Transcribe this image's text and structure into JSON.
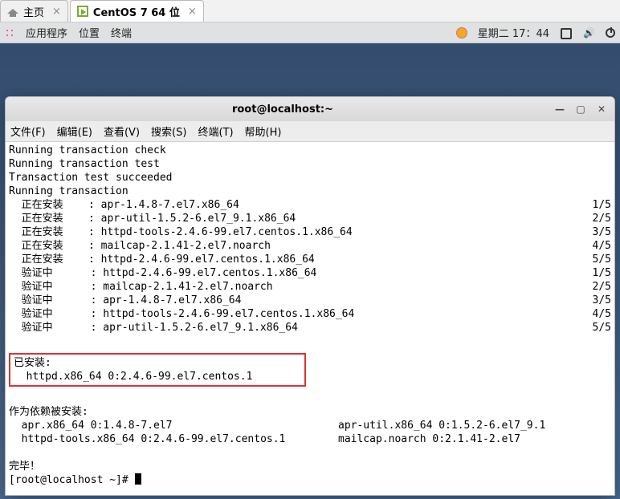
{
  "outer_tabs": {
    "home": "主页",
    "vm": "CentOS 7 64 位"
  },
  "gnome": {
    "apps": "应用程序",
    "places": "位置",
    "terminal": "终端",
    "clock": "星期二 17：44"
  },
  "window": {
    "title": "root@localhost:~"
  },
  "menu": {
    "file": "文件(F)",
    "edit": "编辑(E)",
    "view": "查看(V)",
    "search": "搜索(S)",
    "terminal": "终端(T)",
    "help": "帮助(H)"
  },
  "output": {
    "line1": "Running transaction check",
    "line2": "Running transaction test",
    "line3": "Transaction test succeeded",
    "line4": "Running transaction",
    "install_label": "  正在安装    : ",
    "verify_label": "  验证中      : ",
    "installs": [
      {
        "pkg": "apr-1.4.8-7.el7.x86_64",
        "prog": "1/5"
      },
      {
        "pkg": "apr-util-1.5.2-6.el7_9.1.x86_64",
        "prog": "2/5"
      },
      {
        "pkg": "httpd-tools-2.4.6-99.el7.centos.1.x86_64",
        "prog": "3/5"
      },
      {
        "pkg": "mailcap-2.1.41-2.el7.noarch",
        "prog": "4/5"
      },
      {
        "pkg": "httpd-2.4.6-99.el7.centos.1.x86_64",
        "prog": "5/5"
      }
    ],
    "verifies": [
      {
        "pkg": "httpd-2.4.6-99.el7.centos.1.x86_64",
        "prog": "1/5"
      },
      {
        "pkg": "mailcap-2.1.41-2.el7.noarch",
        "prog": "2/5"
      },
      {
        "pkg": "apr-1.4.8-7.el7.x86_64",
        "prog": "3/5"
      },
      {
        "pkg": "httpd-tools-2.4.6-99.el7.centos.1.x86_64",
        "prog": "4/5"
      },
      {
        "pkg": "apr-util-1.5.2-6.el7_9.1.x86_64",
        "prog": "5/5"
      }
    ],
    "installed_h": "已安装:",
    "installed_l": "  httpd.x86_64 0:2.4.6-99.el7.centos.1",
    "deps_h": "作为依赖被安装:",
    "deps_l1a": "  apr.x86_64 0:1.4.8-7.el7",
    "deps_l1b": "apr-util.x86_64 0:1.5.2-6.el7_9.1",
    "deps_l2a": "  httpd-tools.x86_64 0:2.4.6-99.el7.centos.1",
    "deps_l2b": "mailcap.noarch 0:2.1.41-2.el7",
    "done": "完毕！",
    "prompt": "[root@localhost ~]# "
  }
}
